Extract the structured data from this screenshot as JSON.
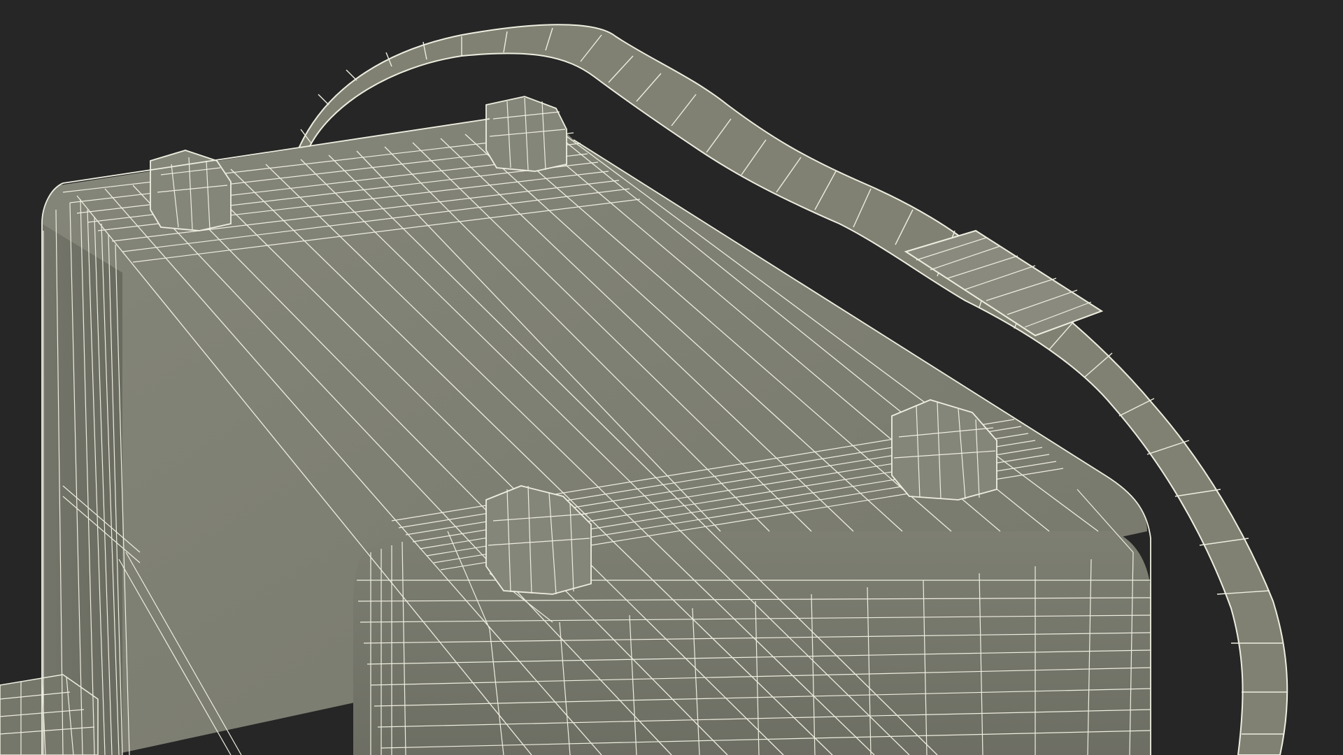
{
  "scene": {
    "subject": "wireframe-3d-model",
    "background_color": "#262626",
    "surface_color": "#7b7c70",
    "surface_shadow_color": "#686a5f",
    "surface_light_color": "#85867a",
    "wire_color": "#eeeee0",
    "strap_color": "#808172"
  }
}
